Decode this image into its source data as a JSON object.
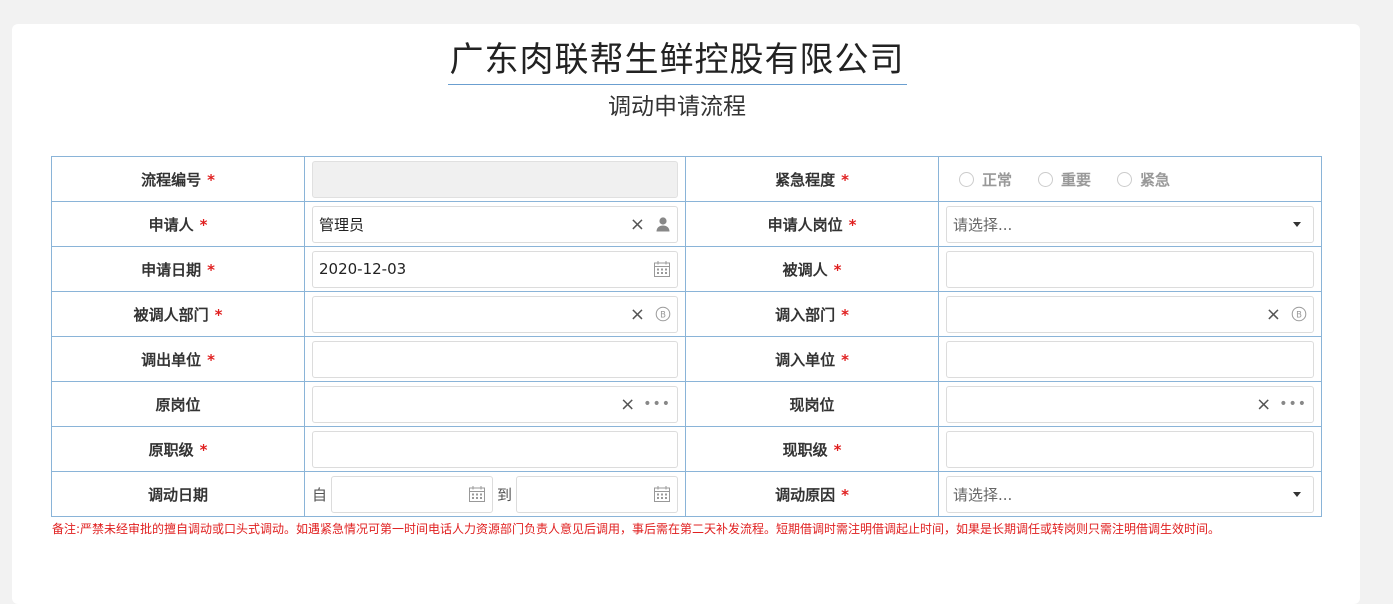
{
  "header": {
    "company": "广东肉联帮生鲜控股有限公司",
    "form_title": "调动申请流程"
  },
  "rows": {
    "process_no": {
      "label": "流程编号",
      "value": ""
    },
    "urgency": {
      "label": "紧急程度",
      "options": [
        "正常",
        "重要",
        "紧急"
      ]
    },
    "applicant": {
      "label": "申请人",
      "value": "管理员"
    },
    "applicant_post": {
      "label": "申请人岗位",
      "placeholder": "请选择..."
    },
    "apply_date": {
      "label": "申请日期",
      "value": "2020-12-03"
    },
    "transferee": {
      "label": "被调人",
      "value": ""
    },
    "transferee_dept": {
      "label": "被调人部门",
      "value": ""
    },
    "in_dept": {
      "label": "调入部门",
      "value": ""
    },
    "out_unit": {
      "label": "调出单位",
      "value": ""
    },
    "in_unit": {
      "label": "调入单位",
      "value": ""
    },
    "orig_post": {
      "label": "原岗位",
      "value": ""
    },
    "curr_post": {
      "label": "现岗位",
      "value": ""
    },
    "orig_level": {
      "label": "原职级",
      "value": ""
    },
    "curr_level": {
      "label": "现职级",
      "value": ""
    },
    "transfer_date": {
      "label": "调动日期",
      "from": "自",
      "to": "到"
    },
    "reason": {
      "label": "调动原因",
      "placeholder": "请选择..."
    }
  },
  "required_mark": "*",
  "icons": {
    "clear": "×",
    "more": "•••"
  },
  "note": "备注:严禁未经审批的擅自调动或口头式调动。如遇紧急情况可第一时间电话人力资源部门负责人意见后调用，事后需在第二天补发流程。短期借调时需注明借调起止时间，如果是长期调任或转岗则只需注明借调生效时间。",
  "colors": {
    "required": "#e02020",
    "border": "#8ab4d8",
    "title_underline": "#6b9fd0"
  }
}
